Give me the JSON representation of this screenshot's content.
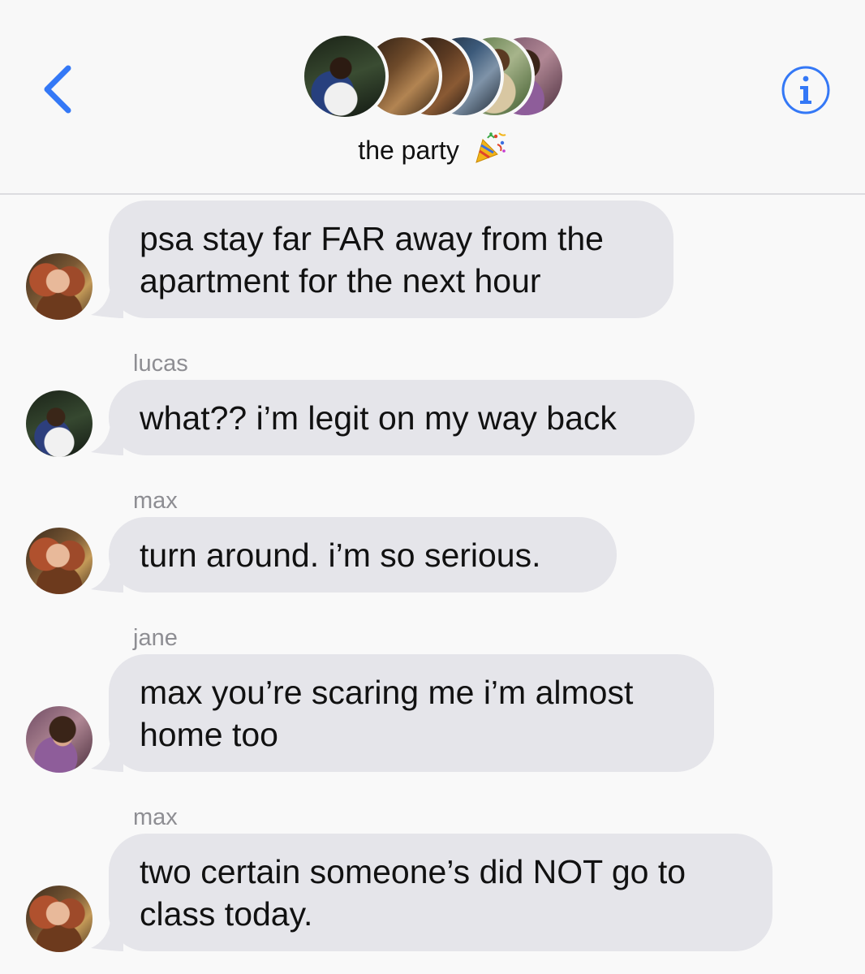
{
  "header": {
    "back_icon": "chevron-left-icon",
    "info_icon": "info-icon",
    "group_name": "the party",
    "group_emoji_icon": "party-popper-icon",
    "accent_color": "#3478f6"
  },
  "messages": [
    {
      "sender": "",
      "lines": [
        "psa stay far FAR away from the",
        "apartment for the next hour"
      ],
      "avatar": "max"
    },
    {
      "sender": "lucas",
      "lines": [
        "what?? i’m legit on my way back"
      ],
      "avatar": "lucas"
    },
    {
      "sender": "max",
      "lines": [
        "turn around. i’m so serious."
      ],
      "avatar": "max"
    },
    {
      "sender": "jane",
      "lines": [
        "max you’re scaring me i’m almost",
        "home too"
      ],
      "avatar": "jane"
    },
    {
      "sender": "max",
      "lines": [
        "two certain someone’s did NOT go to",
        "class today."
      ],
      "avatar": "max"
    }
  ]
}
